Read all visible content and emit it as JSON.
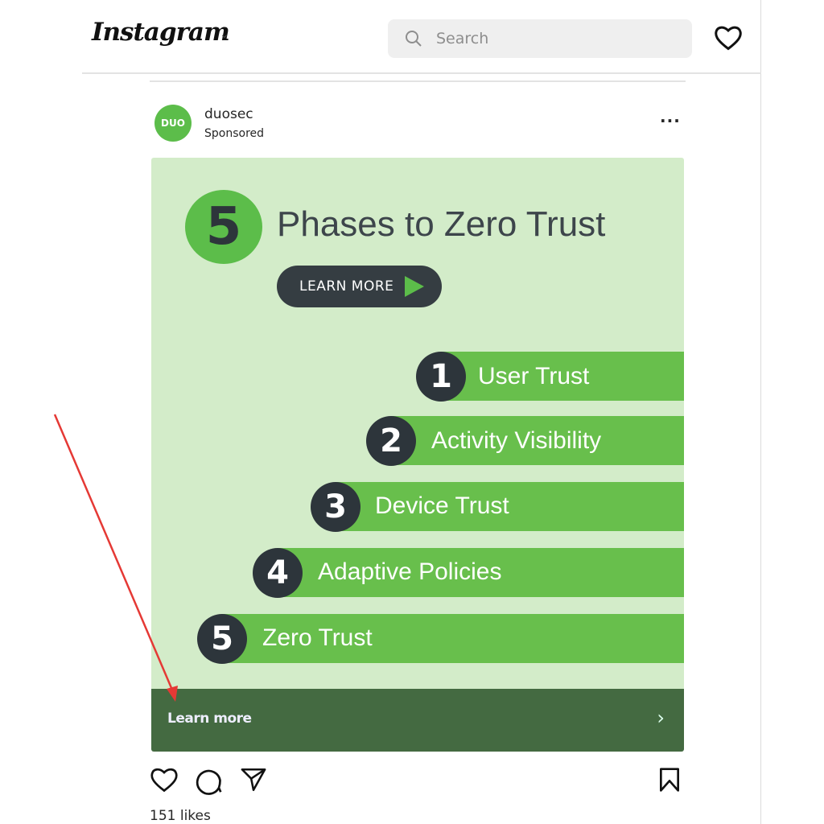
{
  "header": {
    "logo": "Instagram",
    "search_placeholder": "Search"
  },
  "post": {
    "username": "duosec",
    "subtitle": "Sponsored",
    "avatar_text": "DUO",
    "ad": {
      "number": "5",
      "title": "Phases to Zero Trust",
      "button": "LEARN MORE",
      "phases": [
        {
          "n": "1",
          "label": "User Trust"
        },
        {
          "n": "2",
          "label": "Activity Visibility"
        },
        {
          "n": "3",
          "label": "Device Trust"
        },
        {
          "n": "4",
          "label": "Adaptive Policies"
        },
        {
          "n": "5",
          "label": "Zero Trust"
        }
      ]
    },
    "cta": "Learn more",
    "likes": "151 likes"
  },
  "colors": {
    "brand_green": "#5cbd4a",
    "cta_green": "#446a41",
    "annotation_arrow": "#e53935"
  }
}
